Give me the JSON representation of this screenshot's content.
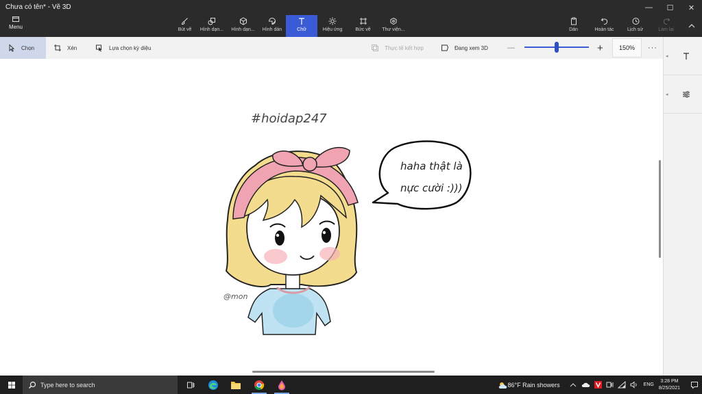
{
  "window": {
    "title": "Chưa có tên* - Vẽ 3D",
    "menu_label": "Menu",
    "controls": {
      "minimize": "—",
      "maximize": "☐",
      "close": "✕"
    }
  },
  "ribbon": {
    "tools": [
      {
        "label": "Bút vẽ",
        "icon": "brush-icon"
      },
      {
        "label": "Hình dạn...",
        "icon": "2d-shapes-icon"
      },
      {
        "label": "Hình dạn...",
        "icon": "3d-shapes-icon"
      },
      {
        "label": "Hình dán",
        "icon": "stickers-icon"
      },
      {
        "label": "Chữ",
        "icon": "text-icon",
        "active": true
      },
      {
        "label": "Hiệu ứng",
        "icon": "effects-icon"
      },
      {
        "label": "Bức vẽ",
        "icon": "canvas-icon"
      },
      {
        "label": "Thư viện...",
        "icon": "3d-library-icon"
      }
    ],
    "right": [
      {
        "label": "Dán",
        "icon": "paste-icon"
      },
      {
        "label": "Hoàn tác",
        "icon": "undo-icon"
      },
      {
        "label": "Lịch sử",
        "icon": "history-icon"
      },
      {
        "label": "Làm lại",
        "icon": "redo-icon",
        "disabled": true
      }
    ]
  },
  "subtoolbar": {
    "select": "Chọn",
    "crop": "Xén",
    "magic_select": "Lựa chọn kỳ diệu",
    "mixed_reality": "Thực tế kết hợp",
    "view_3d": "Đang xem 3D",
    "zoom_minus": "—",
    "zoom_plus": "+",
    "zoom_level": "150%",
    "zoom_fraction": 0.5,
    "more": "···"
  },
  "canvas": {
    "hashtag": "#hoidap247",
    "speech_line1": "haha thật là",
    "speech_line2": "nực cười :)))",
    "signature": "@mon"
  },
  "taskbar": {
    "search_placeholder": "Type here to search",
    "weather": "86°F  Rain showers",
    "language": "ENG",
    "time": "3:28 PM",
    "date": "8/25/2021"
  },
  "colors": {
    "accent": "#3b5bd6",
    "hair": "#f3dc8e",
    "bow": "#f0a3b1",
    "shirt": "#a9d8ee",
    "blush": "#f7b2b9"
  }
}
